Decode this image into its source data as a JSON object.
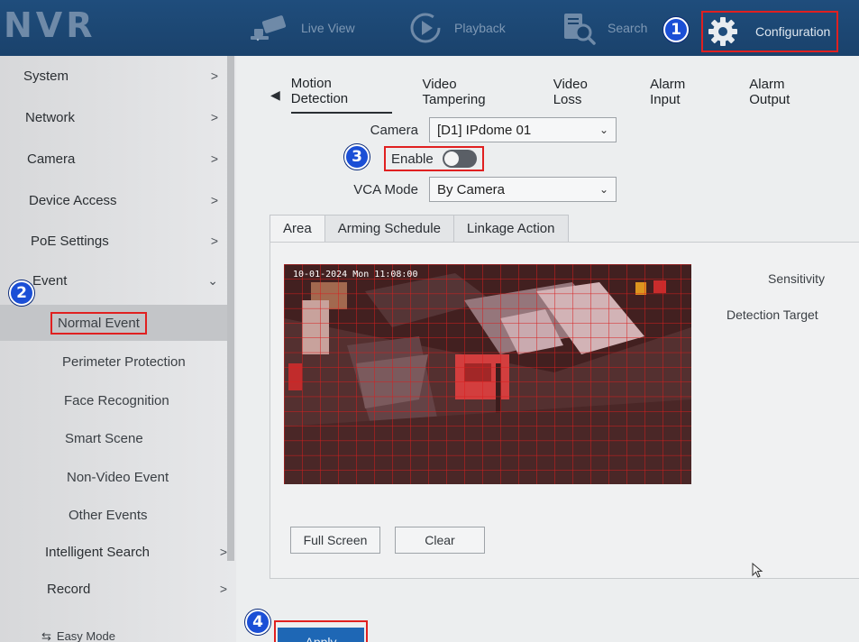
{
  "app": {
    "logo": "NVR"
  },
  "topnav": [
    {
      "label": "Live View",
      "icon": "camera-icon"
    },
    {
      "label": "Playback",
      "icon": "playback-icon"
    },
    {
      "label": "Search",
      "icon": "search-icon"
    },
    {
      "label": "Configuration",
      "icon": "gear-icon",
      "active": true
    }
  ],
  "badges": {
    "b1": "1",
    "b2": "2",
    "b3": "3",
    "b4": "4"
  },
  "sidebar": {
    "items": [
      {
        "label": "System"
      },
      {
        "label": "Network"
      },
      {
        "label": "Camera"
      },
      {
        "label": "Device Access"
      },
      {
        "label": "PoE Settings"
      },
      {
        "label": "Event",
        "expanded": true
      }
    ],
    "event_sub": [
      {
        "label": "Normal Event",
        "active": true
      },
      {
        "label": "Perimeter Protection"
      },
      {
        "label": "Face Recognition"
      },
      {
        "label": "Smart Scene"
      },
      {
        "label": "Non-Video Event"
      },
      {
        "label": "Other Events"
      }
    ],
    "more": [
      {
        "label": "Intelligent Search"
      },
      {
        "label": "Record"
      }
    ],
    "easy_mode": "Easy Mode"
  },
  "tabs": [
    "Motion Detection",
    "Video Tampering",
    "Video Loss",
    "Alarm Input",
    "Alarm Output"
  ],
  "form": {
    "camera_label": "Camera",
    "camera_value": "[D1] IPdome 01",
    "enable_label": "Enable",
    "enable_state": false,
    "vca_label": "VCA Mode",
    "vca_value": "By Camera"
  },
  "subtabs": [
    "Area",
    "Arming Schedule",
    "Linkage Action"
  ],
  "video": {
    "osd": "10-01-2024 Mon 11:08:00"
  },
  "side_labels": {
    "sensitivity": "Sensitivity",
    "detection_target": "Detection Target"
  },
  "buttons": {
    "full_screen": "Full Screen",
    "clear": "Clear",
    "apply": "Apply"
  },
  "colors": {
    "highlight": "#e02020",
    "badge": "#1b4fd6",
    "topbar": "#1f4d7c",
    "apply": "#1e67b5",
    "grid": "#d81e1e"
  }
}
